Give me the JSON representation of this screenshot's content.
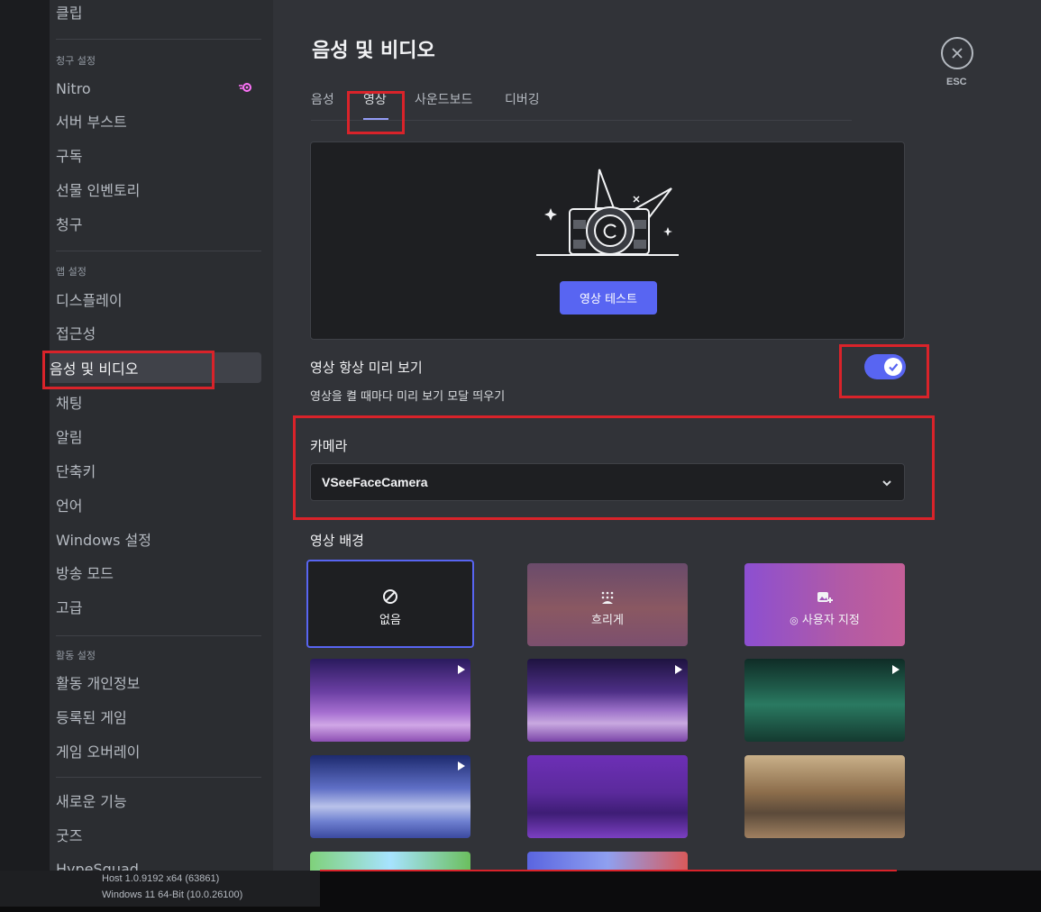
{
  "sidebar": {
    "top_item": "클립",
    "billing_heading": "청구 설정",
    "billing_items": [
      "Nitro",
      "서버 부스트",
      "구독",
      "선물 인벤토리",
      "청구"
    ],
    "app_heading": "앱 설정",
    "app_items": [
      "디스플레이",
      "접근성",
      "음성 및 비디오",
      "채팅",
      "알림",
      "단축키",
      "언어",
      "Windows 설정",
      "방송 모드",
      "고급"
    ],
    "activity_heading": "활동 설정",
    "activity_items": [
      "활동 개인정보",
      "등록된 게임",
      "게임 오버레이"
    ],
    "extra_items": [
      "새로운 기능",
      "굿즈",
      "HypeSquad"
    ]
  },
  "footer": {
    "host": "Host 1.0.9192 x64 (63861)",
    "os": "Windows 11 64-Bit (10.0.26100)"
  },
  "main": {
    "title": "음성 및 비디오",
    "tabs": [
      "음성",
      "영상",
      "사운드보드",
      "디버깅"
    ],
    "active_tab": "영상",
    "test_button": "영상 테스트",
    "always_preview_label": "영상 항상 미리 보기",
    "always_preview_desc": "영상을 켤 때마다 미리 보기 모달 띄우기",
    "always_preview_on": true,
    "camera_label": "카메라",
    "camera_value": "VSeeFaceCamera",
    "background_label": "영상 배경",
    "background_options": [
      "없음",
      "흐리게",
      "사용자 지정"
    ],
    "close_label": "ESC"
  },
  "colors": {
    "accent": "#5865f2",
    "annotation_red": "#d9232a",
    "nitro_pink": "#ff73fa"
  }
}
